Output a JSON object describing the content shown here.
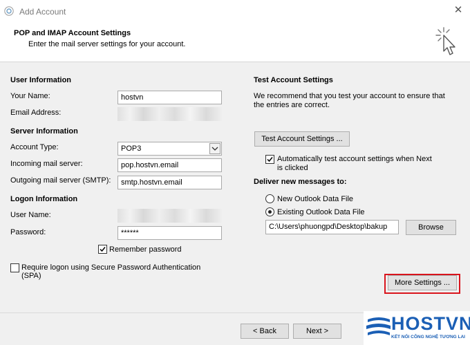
{
  "window": {
    "title": "Add Account",
    "close_glyph": "✕"
  },
  "header": {
    "title": "POP and IMAP Account Settings",
    "subtitle": "Enter the mail server settings for your account."
  },
  "user_info": {
    "heading": "User Information",
    "your_name_label": "Your Name:",
    "your_name_value": "hostvn",
    "email_label": "Email Address:"
  },
  "server_info": {
    "heading": "Server Information",
    "account_type_label": "Account Type:",
    "account_type_value": "POP3",
    "incoming_label": "Incoming mail server:",
    "incoming_value": "pop.hostvn.email",
    "outgoing_label": "Outgoing mail server (SMTP):",
    "outgoing_value": "smtp.hostvn.email"
  },
  "logon_info": {
    "heading": "Logon Information",
    "username_label": "User Name:",
    "password_label": "Password:",
    "password_value": "******",
    "remember_label": "Remember password",
    "remember_checked": true,
    "spa_label_line1": "Require logon using Secure Password Authentication",
    "spa_label_line2": "(SPA)",
    "spa_checked": false
  },
  "test_settings": {
    "heading": "Test Account Settings",
    "desc_line1": "We recommend that you test your account to ensure that",
    "desc_line2": "the entries are correct.",
    "test_button": "Test Account Settings ...",
    "auto_test_line1": "Automatically test account settings when Next",
    "auto_test_line2": "is clicked",
    "auto_test_checked": true
  },
  "delivery": {
    "heading": "Deliver new messages to:",
    "option_new": "New Outlook Data File",
    "option_existing": "Existing Outlook Data File",
    "selected": "existing",
    "path_value": "C:\\Users\\phuongpd\\Desktop\\bakup",
    "browse_button": "Browse"
  },
  "more_settings_button": "More Settings ...",
  "footer": {
    "back_button": "< Back",
    "next_button": "Next >"
  },
  "logo": {
    "brand": "HOSTVN",
    "tagline": "KẾT NỐI CÔNG NGHỆ TƯƠNG LAI"
  },
  "colors": {
    "highlight": "#d9141c",
    "logo_blue": "#1b5fb5"
  }
}
